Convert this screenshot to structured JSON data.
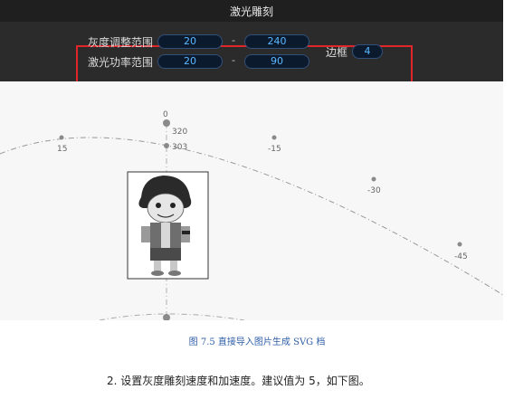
{
  "window": {
    "title": "激光雕刻"
  },
  "toolbar": {
    "gray_range_label": "灰度调整范围",
    "gray_min": "20",
    "gray_max": "240",
    "power_range_label": "激光功率范围",
    "power_min": "20",
    "power_max": "90",
    "separator": "-",
    "border_label": "边框",
    "border_value": "4",
    "highlight_color": "#e0262a"
  },
  "canvas": {
    "tick_labels": {
      "t0": "0",
      "t15": "15",
      "tm15": "-15",
      "tm30": "-30",
      "tm45": "-45",
      "t320": "320",
      "t303": "303"
    },
    "image_subject": "cartoon character (grayscale engraving preview)"
  },
  "document": {
    "caption": "图 7.5  直接导入图片生成 SVG 档",
    "paragraph": "2.   设置灰度雕刻速度和加速度。建议值为 5，如下图。"
  }
}
